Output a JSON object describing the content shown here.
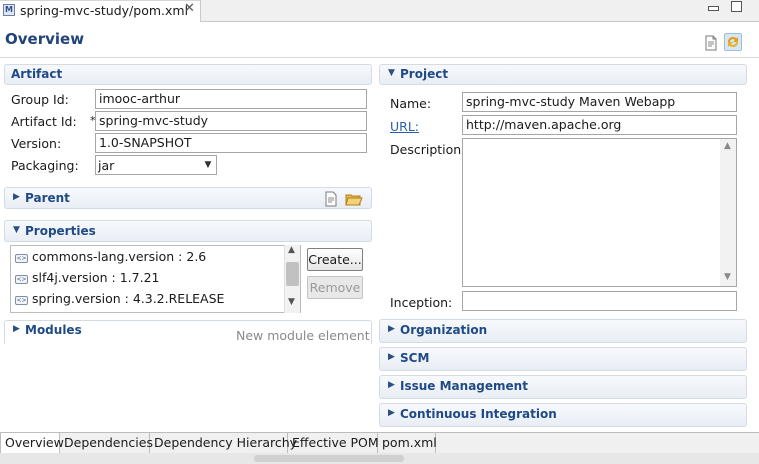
{
  "editor_tab": {
    "icon": "maven-pom-icon",
    "title": "spring-mvc-study/pom.xml",
    "close": "✕"
  },
  "window_controls": {
    "minimize": "minimize-icon",
    "maximize": "maximize-icon"
  },
  "header": {
    "title": "Overview",
    "actions": [
      "show-effective-pom-icon",
      "refresh-icon"
    ]
  },
  "artifact": {
    "title": "Artifact",
    "group_id_label": "Group Id:",
    "group_id": "imooc-arthur",
    "artifact_id_label": "Artifact Id:",
    "required_marker": "*",
    "artifact_id": "spring-mvc-study",
    "version_label": "Version:",
    "version": "1.0-SNAPSHOT",
    "packaging_label": "Packaging:",
    "packaging": "jar"
  },
  "parent": {
    "title": "Parent",
    "actions": [
      "select-parent-icon",
      "open-folder-icon"
    ]
  },
  "properties": {
    "title": "Properties",
    "items": [
      {
        "icon": "property-icon",
        "text": "commons-lang.version : 2.6"
      },
      {
        "icon": "property-icon",
        "text": "slf4j.version : 1.7.21"
      },
      {
        "icon": "property-icon",
        "text": "spring.version : 4.3.2.RELEASE"
      }
    ],
    "create_label": "Create...",
    "remove_label": "Remove"
  },
  "modules": {
    "title": "Modules",
    "hint": "New module element"
  },
  "project": {
    "title": "Project",
    "name_label": "Name:",
    "name": "spring-mvc-study Maven Webapp",
    "url_label": "URL:",
    "url": "http://maven.apache.org",
    "description_label": "Description:",
    "description": "",
    "inception_label": "Inception:",
    "inception": ""
  },
  "collapsed_sections": [
    "Organization",
    "SCM",
    "Issue Management",
    "Continuous Integration"
  ],
  "bottom_tabs": [
    "Overview",
    "Dependencies",
    "Dependency Hierarchy",
    "Effective POM",
    "pom.xml"
  ],
  "colors": {
    "section_title": "#1f4a86",
    "page_title": "#20437a",
    "link": "#2a5db0"
  }
}
